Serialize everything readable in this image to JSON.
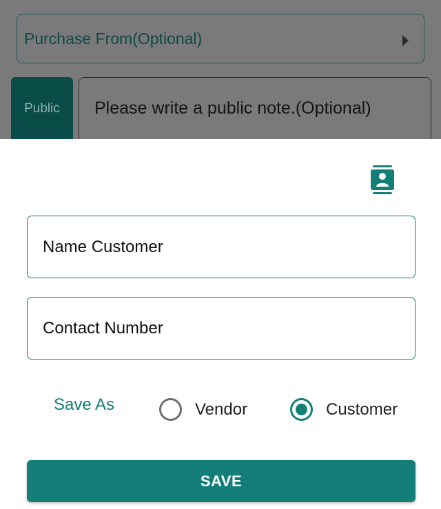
{
  "background_form": {
    "purchase_from_label": "Purchase From(Optional)",
    "public_tab_label": "Public",
    "public_note_placeholder": "Please write a public note.(Optional)"
  },
  "sheet": {
    "name_field_placeholder": "Name Customer",
    "contact_field_placeholder": "Contact Number",
    "save_as_label": "Save As",
    "options": [
      {
        "label": "Vendor",
        "selected": false
      },
      {
        "label": "Customer",
        "selected": true
      }
    ],
    "save_button_label": "SAVE"
  },
  "icons": {
    "purchase_arrow": "arrow-right-icon",
    "contacts": "contacts-book-icon"
  },
  "colors": {
    "accent": "#137f78",
    "dim_overlay": "#7a7a7a"
  }
}
